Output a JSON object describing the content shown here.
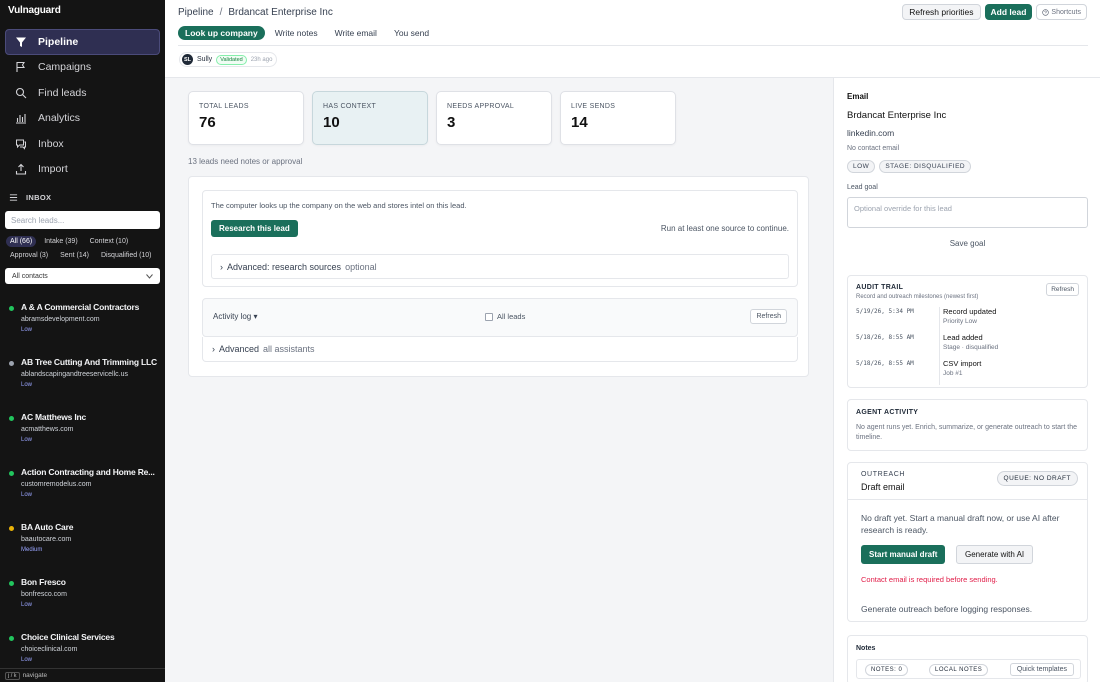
{
  "brand": "Vulnaguard",
  "nav": [
    {
      "label": "Pipeline",
      "icon": "filter-icon",
      "active": true
    },
    {
      "label": "Campaigns",
      "icon": "flag-icon"
    },
    {
      "label": "Find leads",
      "icon": "search-icon"
    },
    {
      "label": "Analytics",
      "icon": "bar-chart-icon"
    },
    {
      "label": "Inbox",
      "icon": "chat-icon"
    },
    {
      "label": "Import",
      "icon": "upload-icon"
    }
  ],
  "inbox": {
    "heading": "INBOX",
    "search_placeholder": "Search leads...",
    "filters": [
      "All (66)",
      "Intake (39)",
      "Context (10)",
      "Approval (3)",
      "Sent (14)",
      "Disqualified (10)"
    ],
    "contacts_select": "All contacts"
  },
  "leads": [
    {
      "name": "A & A Commercial Contractors",
      "domain": "abramsdevelopment.com",
      "priority": "Low",
      "dot": "#22c55e"
    },
    {
      "name": "AB Tree Cutting And Trimming LLC",
      "domain": "ablandscapingandtreeservicellc.us",
      "priority": "Low",
      "dot": "#9ca3af"
    },
    {
      "name": "AC Matthews Inc",
      "domain": "acmatthews.com",
      "priority": "Low",
      "dot": "#22c55e"
    },
    {
      "name": "Action Contracting and Home Re...",
      "domain": "customremodelus.com",
      "priority": "Low",
      "dot": "#22c55e"
    },
    {
      "name": "BA Auto Care",
      "domain": "baautocare.com",
      "priority": "Medium",
      "dot": "#eab308"
    },
    {
      "name": "Bon Fresco",
      "domain": "bonfresco.com",
      "priority": "Low",
      "dot": "#22c55e"
    },
    {
      "name": "Choice Clinical Services",
      "domain": "choiceclinical.com",
      "priority": "Low",
      "dot": "#22c55e"
    }
  ],
  "kb_hint": {
    "keys": "j / k",
    "label": "navigate"
  },
  "header": {
    "crumb_root": "Pipeline",
    "crumb_sep": "/",
    "crumb_current": "Brdancat Enterprise Inc",
    "refresh_label": "Refresh priorities",
    "add_label": "Add lead",
    "shortcuts_label": "Shortcuts"
  },
  "tabs": [
    "Look up company",
    "Write notes",
    "Write email",
    "You send"
  ],
  "owner": {
    "initials": "SL",
    "name": "Sully",
    "badge": "Validated",
    "ago": "23h ago"
  },
  "stats": [
    {
      "label": "TOTAL LEADS",
      "value": "76"
    },
    {
      "label": "HAS CONTEXT",
      "value": "10"
    },
    {
      "label": "NEEDS APPROVAL",
      "value": "3"
    },
    {
      "label": "LIVE SENDS",
      "value": "14"
    }
  ],
  "need_note": "13 leads need notes or approval",
  "research": {
    "desc": "The computer looks up the company on the web and stores intel on this lead.",
    "button": "Research this lead",
    "run_msg": "Run at least one source to continue.",
    "adv_label": "Advanced: research sources",
    "adv_opt": "optional"
  },
  "activity": {
    "title": "Activity log",
    "all_leads": "All leads",
    "refresh": "Refresh",
    "adv_label": "Advanced",
    "adv_opt": "all assistants"
  },
  "right": {
    "email_heading": "Email",
    "company": "Brdancat Enterprise Inc",
    "link": "linkedin.com",
    "no_contact": "No contact email",
    "tags": [
      "LOW",
      "STAGE: DISQUALIFIED"
    ],
    "goal_label": "Lead goal",
    "goal_placeholder": "Optional override for this lead",
    "save_goal": "Save goal"
  },
  "audit": {
    "title": "AUDIT TRAIL",
    "subtitle": "Record and outreach milestones (newest first)",
    "refresh": "Refresh",
    "events": [
      {
        "ts": "5/19/26, 5:34 PM",
        "title": "Record updated",
        "detail": "Priority Low"
      },
      {
        "ts": "5/18/26, 8:55 AM",
        "title": "Lead added",
        "detail": "Stage · disqualified"
      },
      {
        "ts": "5/18/26, 8:55 AM",
        "title": "CSV import",
        "detail": "Job #1"
      }
    ]
  },
  "agent": {
    "title": "AGENT ACTIVITY",
    "body": "No agent runs yet. Enrich, summarize, or generate outreach to start the timeline."
  },
  "outreach": {
    "label": "OUTREACH",
    "title": "Draft email",
    "queue": "QUEUE: NO DRAFT",
    "msg": "No draft yet. Start a manual draft now, or use AI after research is ready.",
    "manual": "Start manual draft",
    "ai": "Generate with AI",
    "error": "Contact email is required before sending.",
    "gen_note": "Generate outreach before logging responses."
  },
  "notes": {
    "title": "Notes",
    "count": "NOTES: 0",
    "local": "LOCAL NOTES",
    "templates": "Quick templates"
  },
  "colors": {
    "accent": "#1a6f5b",
    "sidebar": "#141414",
    "error": "#e11d48"
  }
}
